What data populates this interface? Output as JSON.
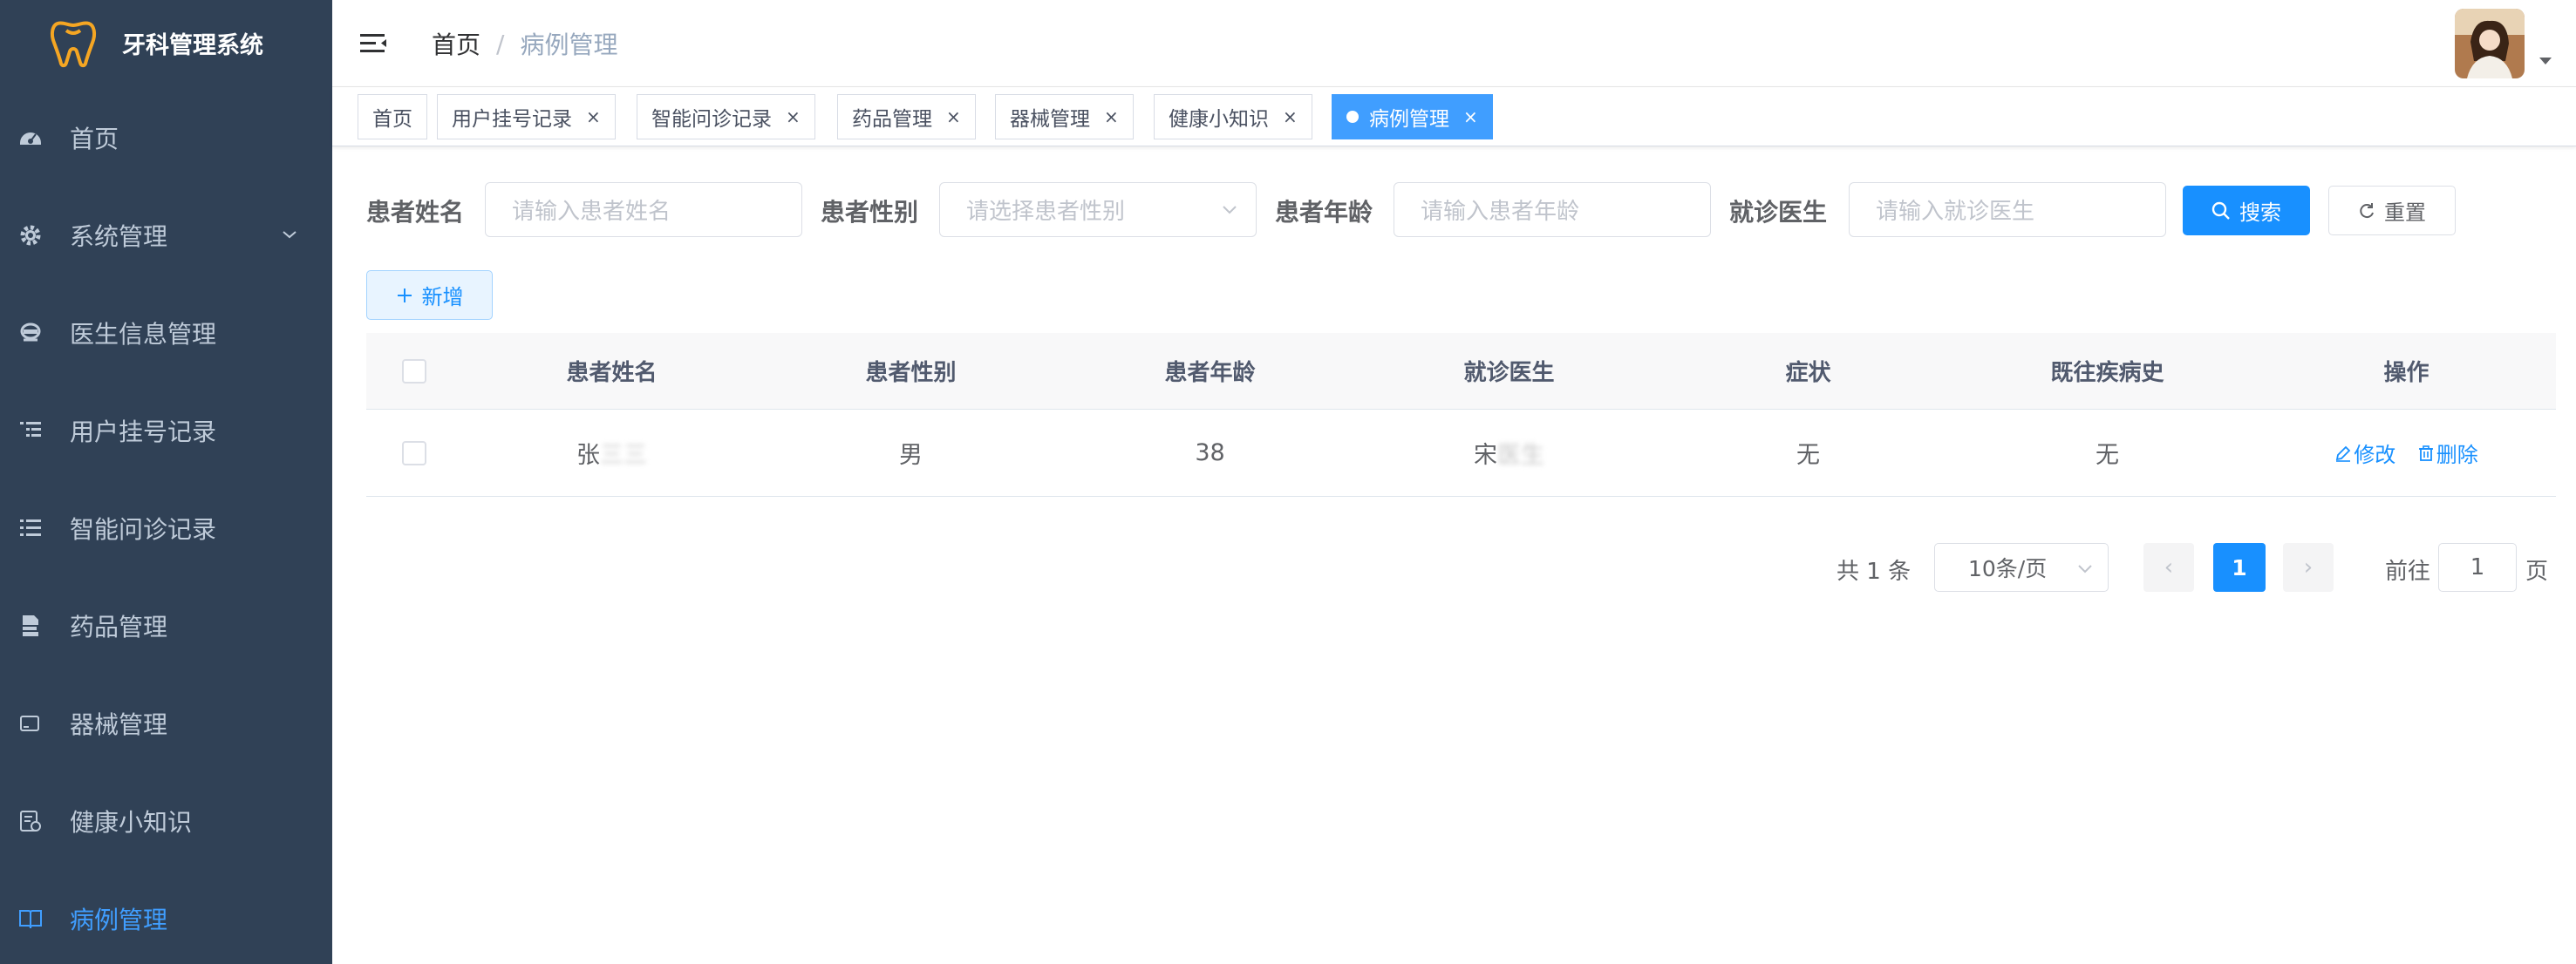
{
  "app": {
    "title": "牙科管理系统"
  },
  "sidebar": {
    "items": [
      {
        "label": "首页",
        "icon": "dashboard-icon"
      },
      {
        "label": "系统管理",
        "icon": "gear-icon"
      },
      {
        "label": "医生信息管理",
        "icon": "doctor-icon"
      },
      {
        "label": "用户挂号记录",
        "icon": "list-tree-icon"
      },
      {
        "label": "智能问诊记录",
        "icon": "list-icon"
      },
      {
        "label": "药品管理",
        "icon": "pdf-icon"
      },
      {
        "label": "器械管理",
        "icon": "tablet-icon"
      },
      {
        "label": "健康小知识",
        "icon": "knowledge-icon"
      },
      {
        "label": "病例管理",
        "icon": "book-icon"
      }
    ],
    "active_index": 8
  },
  "header": {
    "breadcrumb": {
      "home": "首页",
      "separator": "/",
      "current": "病例管理"
    }
  },
  "tags": [
    {
      "label": "首页"
    },
    {
      "label": "用户挂号记录",
      "close": "×"
    },
    {
      "label": "智能问诊记录",
      "close": "×"
    },
    {
      "label": "药品管理",
      "close": "×"
    },
    {
      "label": "器械管理",
      "close": "×"
    },
    {
      "label": "健康小知识",
      "close": "×"
    },
    {
      "label": "病例管理",
      "close": "×",
      "active": true
    }
  ],
  "search": {
    "name_label": "患者姓名",
    "name_placeholder": "请输入患者姓名",
    "gender_label": "患者性别",
    "gender_placeholder": "请选择患者性别",
    "age_label": "患者年龄",
    "age_placeholder": "请输入患者年龄",
    "doctor_label": "就诊医生",
    "doctor_placeholder": "请输入就诊医生",
    "search_button": "搜索",
    "reset_button": "重置"
  },
  "toolbar": {
    "add_button": "新增"
  },
  "table": {
    "columns": [
      "患者姓名",
      "患者性别",
      "患者年龄",
      "就诊医生",
      "症状",
      "既往疾病史",
      "操作"
    ],
    "rows": [
      {
        "name_visible": "张",
        "name_hidden": "三三",
        "gender": "男",
        "age": "38",
        "doctor_visible": "宋",
        "doctor_hidden": "医生",
        "symptom": "无",
        "history": "无",
        "edit": "修改",
        "delete": "删除"
      }
    ]
  },
  "pagination": {
    "total": "共 1 条",
    "page_size": "10条/页",
    "current_page": "1",
    "goto_label": "前往",
    "goto_value": "1",
    "page_suffix": "页",
    "prev": "‹",
    "next": "›"
  },
  "colors": {
    "sidebar_bg": "#304156",
    "sidebar_text": "#bfcbd9",
    "primary": "#1890ff",
    "active_tag": "#409eff"
  }
}
